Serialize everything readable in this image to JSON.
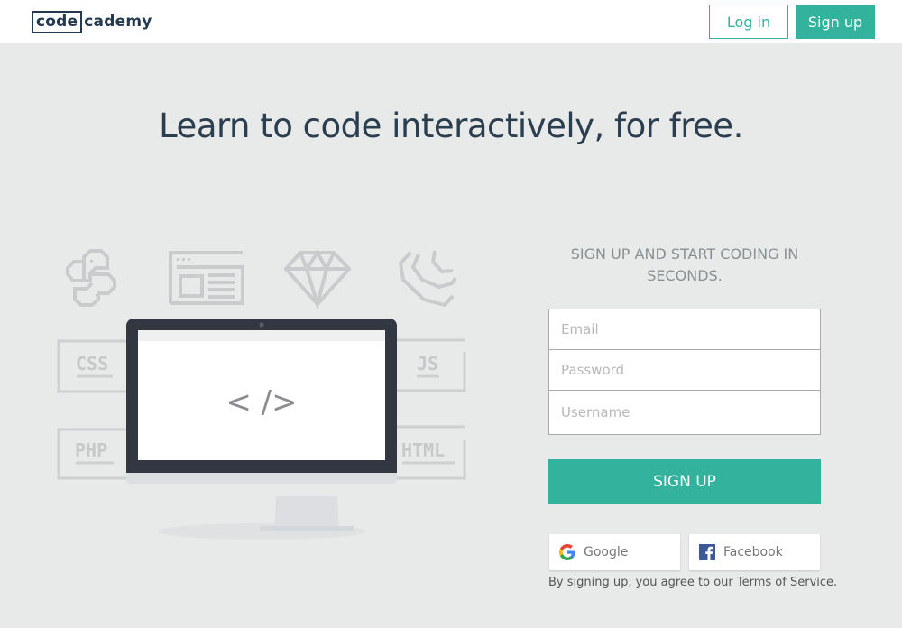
{
  "header": {
    "logo_boxed": "code",
    "logo_rest": "cademy",
    "login_label": "Log in",
    "signup_label": "Sign up"
  },
  "hero": {
    "headline": "Learn to code interactively, for free."
  },
  "illustration": {
    "language_tags": [
      "CSS",
      "PHP",
      "JS",
      "HTML"
    ],
    "screen_code": "< />",
    "icons": [
      "python-icon",
      "browser-window-icon",
      "ruby-gem-icon",
      "jquery-icon"
    ]
  },
  "signup_form": {
    "tagline": "SIGN UP AND START CODING IN SECONDS.",
    "email_placeholder": "Email",
    "password_placeholder": "Password",
    "username_placeholder": "Username",
    "submit_label": "SIGN UP",
    "google_label": "Google",
    "facebook_label": "Facebook",
    "terms_prefix": "By signing up, you agree to our ",
    "terms_link": "Terms of Service",
    "terms_suffix": "."
  },
  "colors": {
    "accent": "#33b39e",
    "background": "#e8eaea",
    "text_dark": "#2b3e50",
    "monitor_frame": "#323741"
  }
}
